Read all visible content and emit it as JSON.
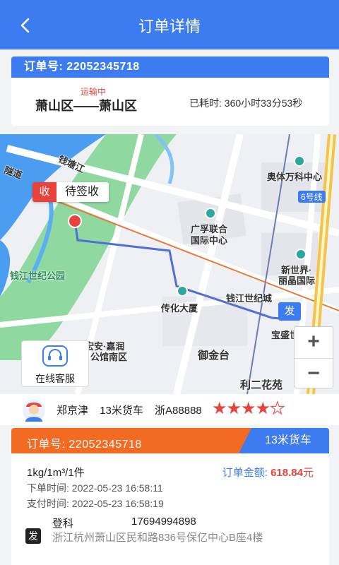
{
  "nav": {
    "title": "订单详情",
    "back_icon": "chevron-left-icon"
  },
  "summary": {
    "order_label": "订单号:",
    "order_no": "22052345718",
    "status": "运输中",
    "route": "萧山区——萧山区",
    "elapsed": "已耗时: 360小时33分53秒"
  },
  "map": {
    "sign_badge": "收",
    "sign_text": "待签收",
    "send_badge": "发",
    "labels": {
      "qianjiang": "钱塘江",
      "tunnel": "隧道",
      "park": "钱江世纪公园",
      "olympic": "奥体万科中心",
      "line6": "6号线",
      "guangfu": "广孚联合",
      "guangfu2": "国际中心",
      "xinshijie": "新世界·",
      "xinshijie2": "丽晶国际",
      "chuanhua": "传化大厦",
      "qianjiangcity": "钱江世纪城",
      "baosheng": "宝盛世纪中心",
      "jiarun": "宏安·嘉润",
      "jiarun2": "公馆南区",
      "yujintai": "御金台",
      "lier": "利二花苑"
    },
    "zoom_in": "+",
    "zoom_out": "−",
    "service_label": "在线客服",
    "service_icon": "headset-icon"
  },
  "driver": {
    "name": "郑京津",
    "vehicle": "13米货车",
    "plate": "浙A88888",
    "rating": 4,
    "rating_max": 5
  },
  "order": {
    "label": "订单号:",
    "order_no": "22052345718",
    "vehicle_type": "13米货车",
    "cargo": "1kg/1m³/1件",
    "amount_label": "订单金额:",
    "amount": "618.84",
    "amount_unit": "元",
    "created": "下单时间: 2022-05-23 16:58:11",
    "paid": "支付时间: 2022-05-23 16:58:19",
    "sender_badge": "发",
    "sender_name": "登科",
    "sender_phone": "17694994898",
    "sender_address": "浙江杭州萧山区民和路836号保亿中心B座4楼"
  },
  "colors": {
    "primary": "#3c7bf0",
    "accent": "#f36b23",
    "danger": "#e8433a"
  }
}
